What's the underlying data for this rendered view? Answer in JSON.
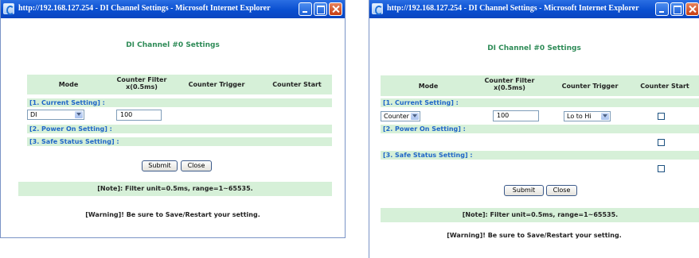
{
  "windows": [
    {
      "title": "http://192.168.127.254 - DI Channel Settings - Microsoft Internet Explorer",
      "heading": "DI Channel #0 Settings",
      "columns": {
        "mode": "Mode",
        "filter_line1": "Counter Filter",
        "filter_line2": "x(0.5ms)",
        "trigger": "Counter Trigger",
        "start": "Counter Start"
      },
      "sections": [
        "[1. Current Setting] :",
        "[2. Power On Setting] :",
        "[3. Safe Status Setting] :"
      ],
      "current": {
        "mode": "DI",
        "filter": "100"
      },
      "submit_label": "Submit",
      "close_label": "Close",
      "note": "[Note]: Filter unit=0.5ms, range=1~65535.",
      "warning": "[Warning]! Be sure to Save/Restart your setting."
    },
    {
      "title": "http://192.168.127.254 - DI Channel Settings - Microsoft Internet Explorer",
      "heading": "DI Channel #0 Settings",
      "columns": {
        "mode": "Mode",
        "filter_line1": "Counter Filter",
        "filter_line2": "x(0.5ms)",
        "trigger": "Counter Trigger",
        "start": "Counter Start"
      },
      "sections": [
        "[1. Current Setting] :",
        "[2. Power On Setting] :",
        "[3. Safe Status Setting] :"
      ],
      "current": {
        "mode": "Counter",
        "filter": "100",
        "trigger": "Lo to Hi",
        "start_checked": false
      },
      "power_on": {
        "start_checked": false
      },
      "safe_status": {
        "start_checked": false
      },
      "submit_label": "Submit",
      "close_label": "Close",
      "note": "[Note]: Filter unit=0.5ms, range=1~65535.",
      "warning": "[Warning]! Be sure to Save/Restart your setting."
    }
  ]
}
